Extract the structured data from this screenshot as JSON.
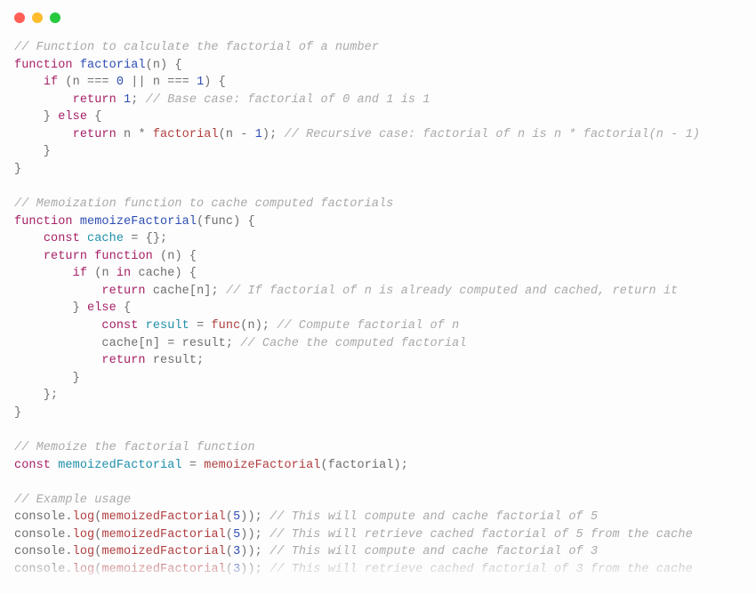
{
  "traffic": {
    "red": "#ff5f56",
    "yellow": "#ffbd2e",
    "green": "#27c93f"
  },
  "palette": {
    "comment": "#a9a9a9",
    "keyword": "#a61f65",
    "funcdef": "#2d4db3",
    "ident": "#1e8fa9",
    "call": "#b13e3e",
    "number": "#2d4db3",
    "punct": "#6e6e6e"
  },
  "code_lines": [
    [
      [
        "c",
        "// Function to calculate the factorial of a number"
      ]
    ],
    [
      [
        "kw",
        "function"
      ],
      [
        "p",
        " "
      ],
      [
        "fn",
        "factorial"
      ],
      [
        "p",
        "("
      ],
      [
        "txt",
        "n"
      ],
      [
        "p",
        ") {"
      ]
    ],
    [
      [
        "p",
        "    "
      ],
      [
        "kw",
        "if"
      ],
      [
        "p",
        " ("
      ],
      [
        "txt",
        "n "
      ],
      [
        "op",
        "==="
      ],
      [
        "p",
        " "
      ],
      [
        "num",
        "0"
      ],
      [
        "p",
        " "
      ],
      [
        "op",
        "||"
      ],
      [
        "p",
        " "
      ],
      [
        "txt",
        "n "
      ],
      [
        "op",
        "==="
      ],
      [
        "p",
        " "
      ],
      [
        "num",
        "1"
      ],
      [
        "p",
        ") {"
      ]
    ],
    [
      [
        "p",
        "        "
      ],
      [
        "kw",
        "return"
      ],
      [
        "p",
        " "
      ],
      [
        "num",
        "1"
      ],
      [
        "p",
        "; "
      ],
      [
        "c",
        "// Base case: factorial of 0 and 1 is 1"
      ]
    ],
    [
      [
        "p",
        "    } "
      ],
      [
        "kw",
        "else"
      ],
      [
        "p",
        " {"
      ]
    ],
    [
      [
        "p",
        "        "
      ],
      [
        "kw",
        "return"
      ],
      [
        "p",
        " "
      ],
      [
        "txt",
        "n "
      ],
      [
        "op",
        "*"
      ],
      [
        "p",
        " "
      ],
      [
        "call",
        "factorial"
      ],
      [
        "p",
        "("
      ],
      [
        "txt",
        "n "
      ],
      [
        "op",
        "-"
      ],
      [
        "p",
        " "
      ],
      [
        "num",
        "1"
      ],
      [
        "p",
        "); "
      ],
      [
        "c",
        "// Recursive case: factorial of n is n * factorial(n - 1)"
      ]
    ],
    [
      [
        "p",
        "    }"
      ]
    ],
    [
      [
        "p",
        "}"
      ]
    ],
    [],
    [
      [
        "c",
        "// Memoization function to cache computed factorials"
      ]
    ],
    [
      [
        "kw",
        "function"
      ],
      [
        "p",
        " "
      ],
      [
        "fn",
        "memoizeFactorial"
      ],
      [
        "p",
        "("
      ],
      [
        "txt",
        "func"
      ],
      [
        "p",
        ") {"
      ]
    ],
    [
      [
        "p",
        "    "
      ],
      [
        "kw",
        "const"
      ],
      [
        "p",
        " "
      ],
      [
        "id",
        "cache"
      ],
      [
        "p",
        " "
      ],
      [
        "op",
        "="
      ],
      [
        "p",
        " {};"
      ]
    ],
    [
      [
        "p",
        "    "
      ],
      [
        "kw",
        "return"
      ],
      [
        "p",
        " "
      ],
      [
        "kw",
        "function"
      ],
      [
        "p",
        " ("
      ],
      [
        "txt",
        "n"
      ],
      [
        "p",
        ") {"
      ]
    ],
    [
      [
        "p",
        "        "
      ],
      [
        "kw",
        "if"
      ],
      [
        "p",
        " ("
      ],
      [
        "txt",
        "n "
      ],
      [
        "kw",
        "in"
      ],
      [
        "p",
        " "
      ],
      [
        "txt",
        "cache"
      ],
      [
        "p",
        ") {"
      ]
    ],
    [
      [
        "p",
        "            "
      ],
      [
        "kw",
        "return"
      ],
      [
        "p",
        " "
      ],
      [
        "txt",
        "cache"
      ],
      [
        "p",
        "["
      ],
      [
        "txt",
        "n"
      ],
      [
        "p",
        "]; "
      ],
      [
        "c",
        "// If factorial of n is already computed and cached, return it"
      ]
    ],
    [
      [
        "p",
        "        } "
      ],
      [
        "kw",
        "else"
      ],
      [
        "p",
        " {"
      ]
    ],
    [
      [
        "p",
        "            "
      ],
      [
        "kw",
        "const"
      ],
      [
        "p",
        " "
      ],
      [
        "id",
        "result"
      ],
      [
        "p",
        " "
      ],
      [
        "op",
        "="
      ],
      [
        "p",
        " "
      ],
      [
        "call",
        "func"
      ],
      [
        "p",
        "("
      ],
      [
        "txt",
        "n"
      ],
      [
        "p",
        "); "
      ],
      [
        "c",
        "// Compute factorial of n"
      ]
    ],
    [
      [
        "p",
        "            "
      ],
      [
        "txt",
        "cache"
      ],
      [
        "p",
        "["
      ],
      [
        "txt",
        "n"
      ],
      [
        "p",
        "] "
      ],
      [
        "op",
        "="
      ],
      [
        "p",
        " "
      ],
      [
        "txt",
        "result"
      ],
      [
        "p",
        "; "
      ],
      [
        "c",
        "// Cache the computed factorial"
      ]
    ],
    [
      [
        "p",
        "            "
      ],
      [
        "kw",
        "return"
      ],
      [
        "p",
        " "
      ],
      [
        "txt",
        "result"
      ],
      [
        "p",
        ";"
      ]
    ],
    [
      [
        "p",
        "        }"
      ]
    ],
    [
      [
        "p",
        "    };"
      ]
    ],
    [
      [
        "p",
        "}"
      ]
    ],
    [],
    [
      [
        "c",
        "// Memoize the factorial function"
      ]
    ],
    [
      [
        "kw",
        "const"
      ],
      [
        "p",
        " "
      ],
      [
        "id",
        "memoizedFactorial"
      ],
      [
        "p",
        " "
      ],
      [
        "op",
        "="
      ],
      [
        "p",
        " "
      ],
      [
        "call",
        "memoizeFactorial"
      ],
      [
        "p",
        "("
      ],
      [
        "txt",
        "factorial"
      ],
      [
        "p",
        ");"
      ]
    ],
    [],
    [
      [
        "c",
        "// Example usage"
      ]
    ],
    [
      [
        "txt",
        "console"
      ],
      [
        "p",
        "."
      ],
      [
        "call",
        "log"
      ],
      [
        "p",
        "("
      ],
      [
        "call",
        "memoizedFactorial"
      ],
      [
        "p",
        "("
      ],
      [
        "num",
        "5"
      ],
      [
        "p",
        ")); "
      ],
      [
        "c",
        "// This will compute and cache factorial of 5"
      ]
    ],
    [
      [
        "txt",
        "console"
      ],
      [
        "p",
        "."
      ],
      [
        "call",
        "log"
      ],
      [
        "p",
        "("
      ],
      [
        "call",
        "memoizedFactorial"
      ],
      [
        "p",
        "("
      ],
      [
        "num",
        "5"
      ],
      [
        "p",
        ")); "
      ],
      [
        "c",
        "// This will retrieve cached factorial of 5 from the cache"
      ]
    ],
    [
      [
        "txt",
        "console"
      ],
      [
        "p",
        "."
      ],
      [
        "call",
        "log"
      ],
      [
        "p",
        "("
      ],
      [
        "call",
        "memoizedFactorial"
      ],
      [
        "p",
        "("
      ],
      [
        "num",
        "3"
      ],
      [
        "p",
        ")); "
      ],
      [
        "c",
        "// This will compute and cache factorial of 3"
      ]
    ],
    [
      [
        "txt",
        "console"
      ],
      [
        "p",
        "."
      ],
      [
        "call",
        "log"
      ],
      [
        "p",
        "("
      ],
      [
        "call",
        "memoizedFactorial"
      ],
      [
        "p",
        "("
      ],
      [
        "num",
        "3"
      ],
      [
        "p",
        ")); "
      ],
      [
        "c",
        "// This will retrieve cached factorial of 3 from the cache"
      ]
    ]
  ]
}
